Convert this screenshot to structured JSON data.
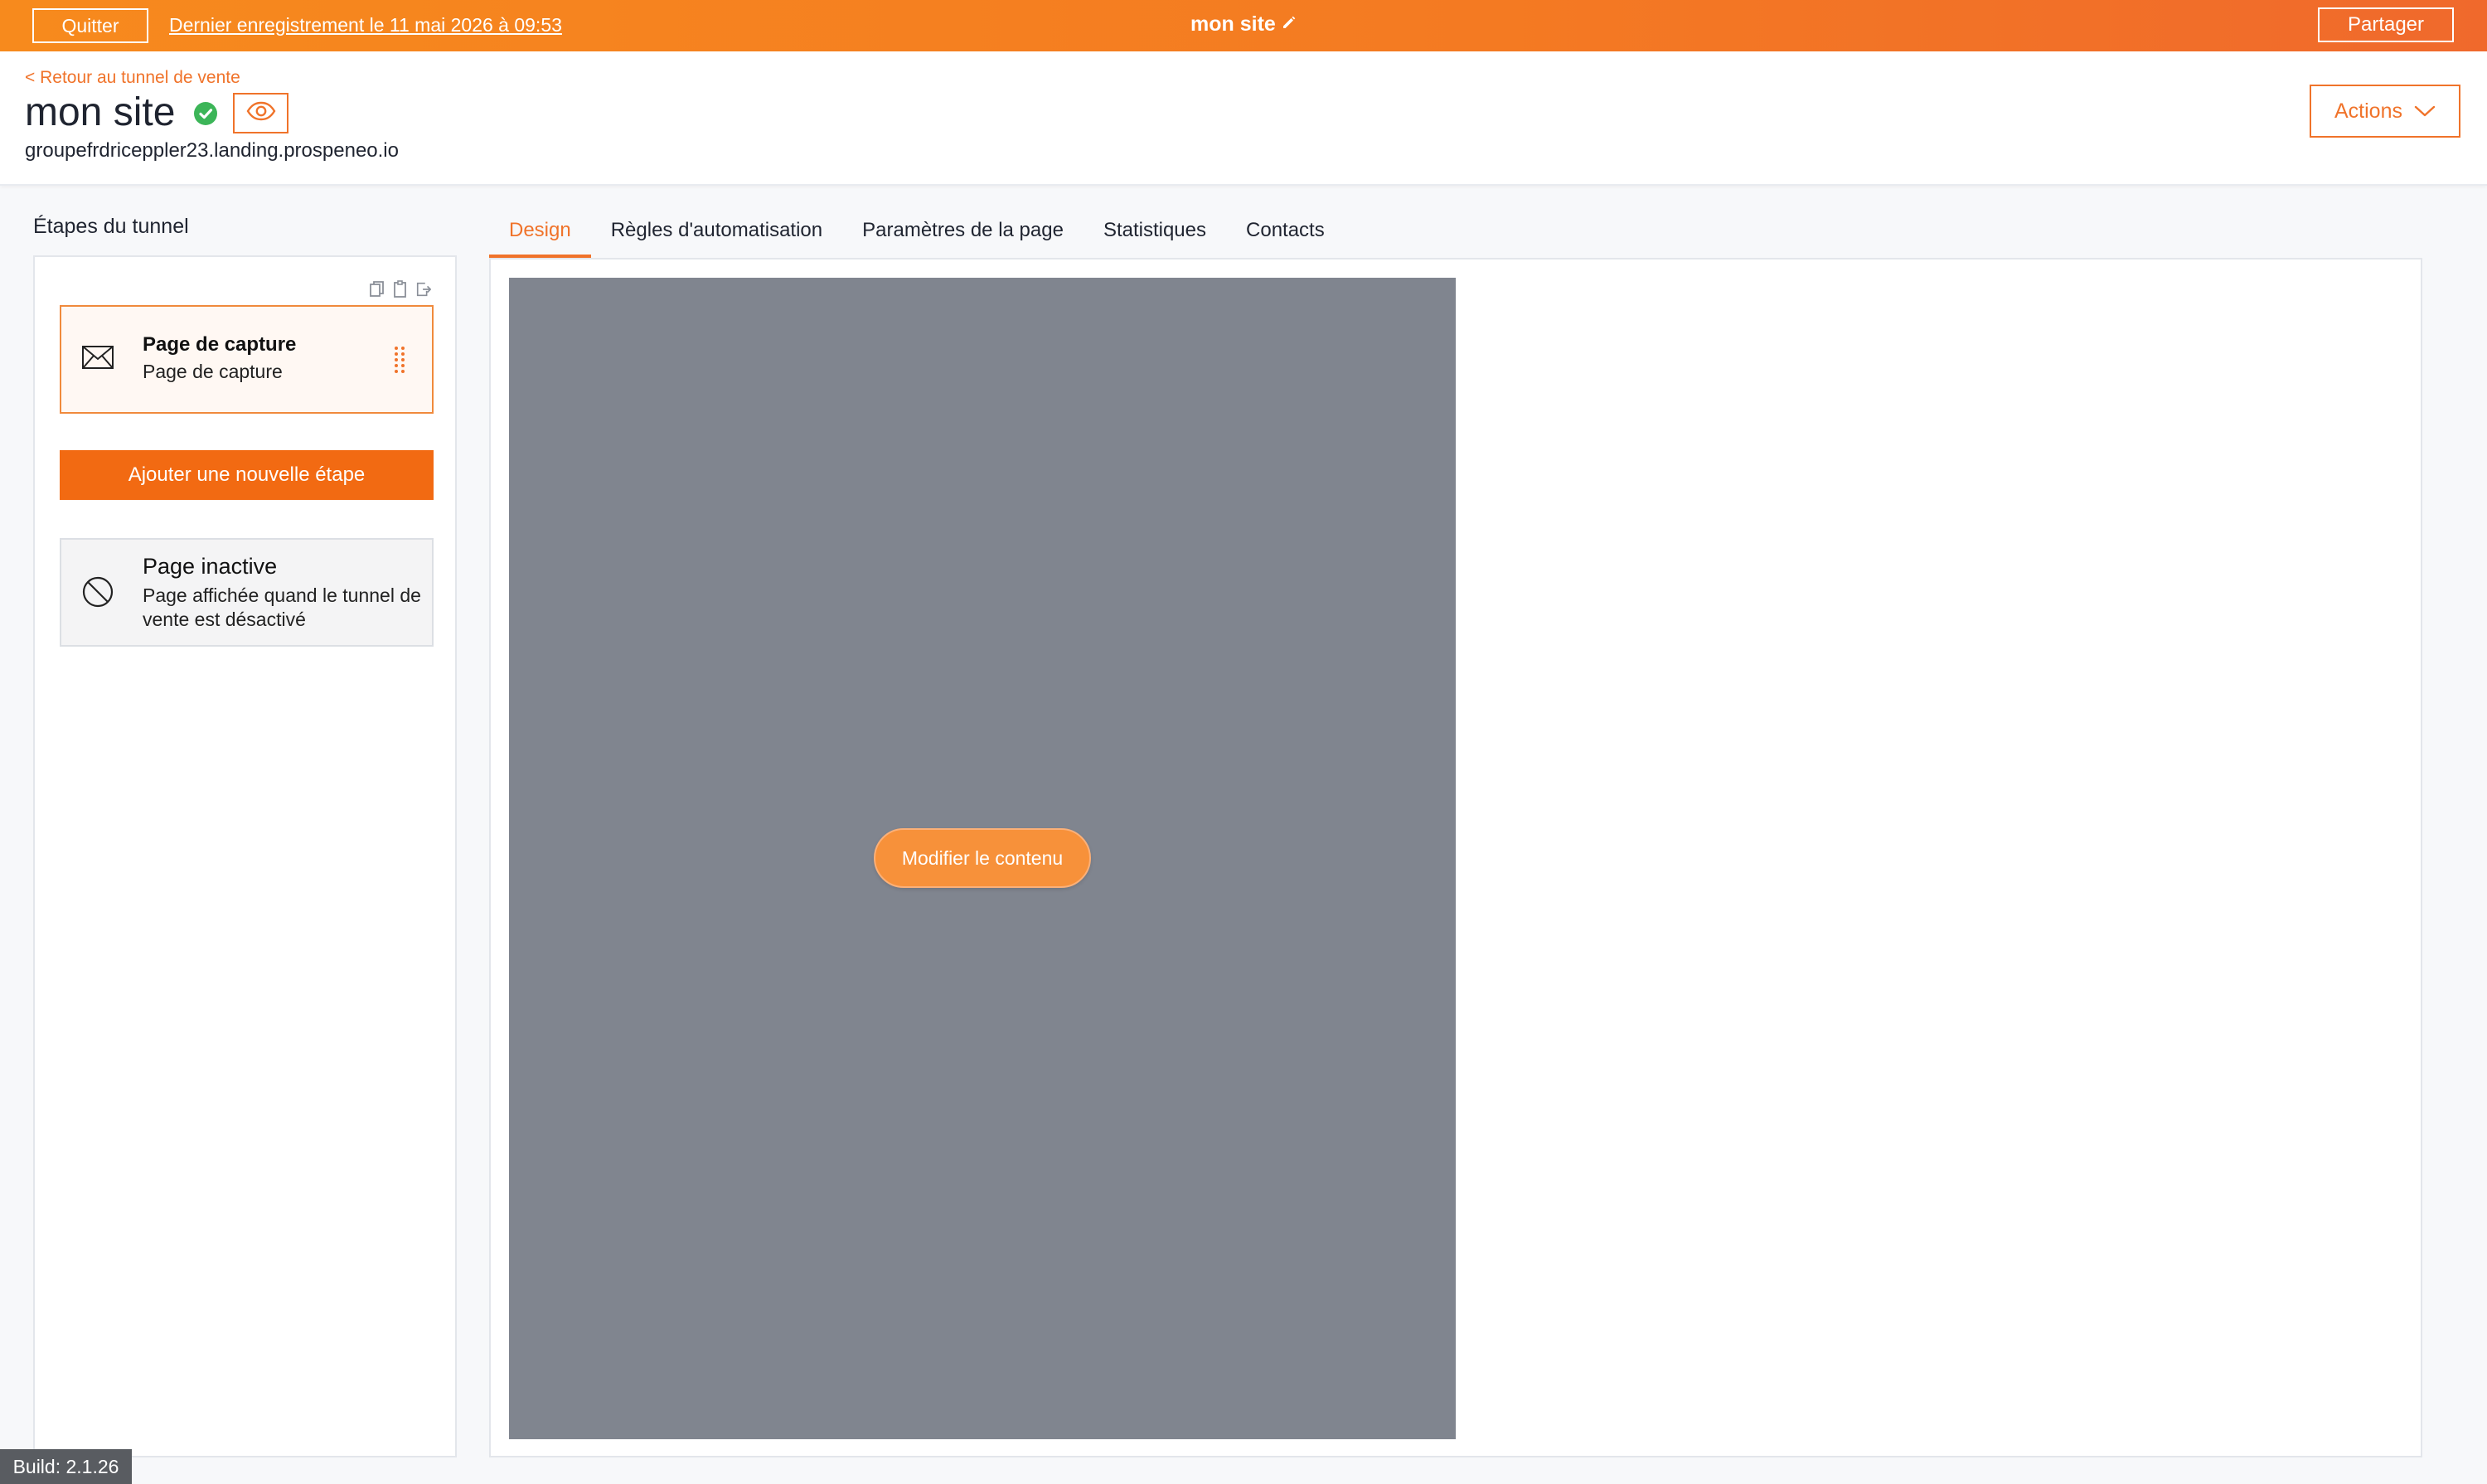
{
  "topbar": {
    "quit_label": "Quitter",
    "last_save": "Dernier enregistrement le 11 mai 2026 à 09:53",
    "site_title": "mon site",
    "share_label": "Partager"
  },
  "header": {
    "back_link": "< Retour au tunnel de vente",
    "page_name": "mon site",
    "domain": "groupefrdriceppler23.landing.prospeneo.io",
    "actions_label": "Actions"
  },
  "steps": {
    "title": "Étapes du tunnel",
    "items": [
      {
        "title": "Page de capture",
        "subtitle": "Page de capture",
        "icon": "envelope-icon"
      }
    ],
    "add_label": "Ajouter une nouvelle étape",
    "inactive": {
      "title": "Page inactive",
      "description": "Page affichée quand le tunnel de vente est désactivé",
      "icon": "ban-icon"
    }
  },
  "tabs": [
    {
      "label": "Design",
      "active": true
    },
    {
      "label": "Règles d'automatisation",
      "active": false
    },
    {
      "label": "Paramètres de la page",
      "active": false
    },
    {
      "label": "Statistiques",
      "active": false
    },
    {
      "label": "Contacts",
      "active": false
    }
  ],
  "design": {
    "edit_label": "Modifier le contenu"
  },
  "build": "Build: 2.1.26",
  "colors": {
    "accent": "#f0732a",
    "topbar": "#f47a22",
    "preview_bg": "#80858f",
    "status_ok": "#3cb558"
  }
}
